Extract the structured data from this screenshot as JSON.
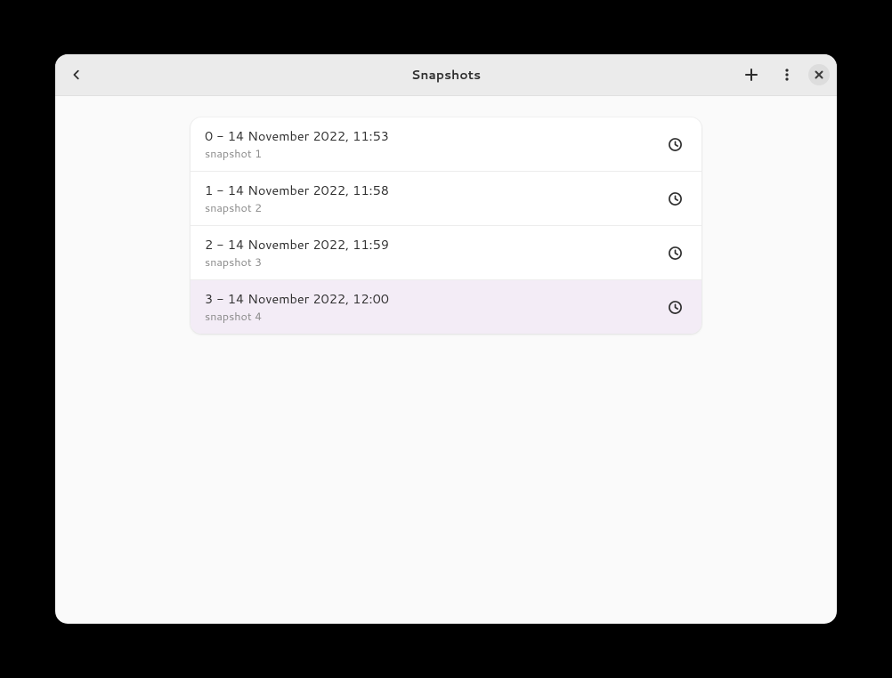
{
  "header": {
    "title": "Snapshots"
  },
  "snapshots": [
    {
      "title": "0 - 14 November 2022, 11:53",
      "sub": "snapshot 1",
      "selected": false
    },
    {
      "title": "1 - 14 November 2022, 11:58",
      "sub": "snapshot 2",
      "selected": false
    },
    {
      "title": "2 - 14 November 2022, 11:59",
      "sub": "snapshot 3",
      "selected": false
    },
    {
      "title": "3 - 14 November 2022, 12:00",
      "sub": "snapshot 4",
      "selected": true
    }
  ]
}
